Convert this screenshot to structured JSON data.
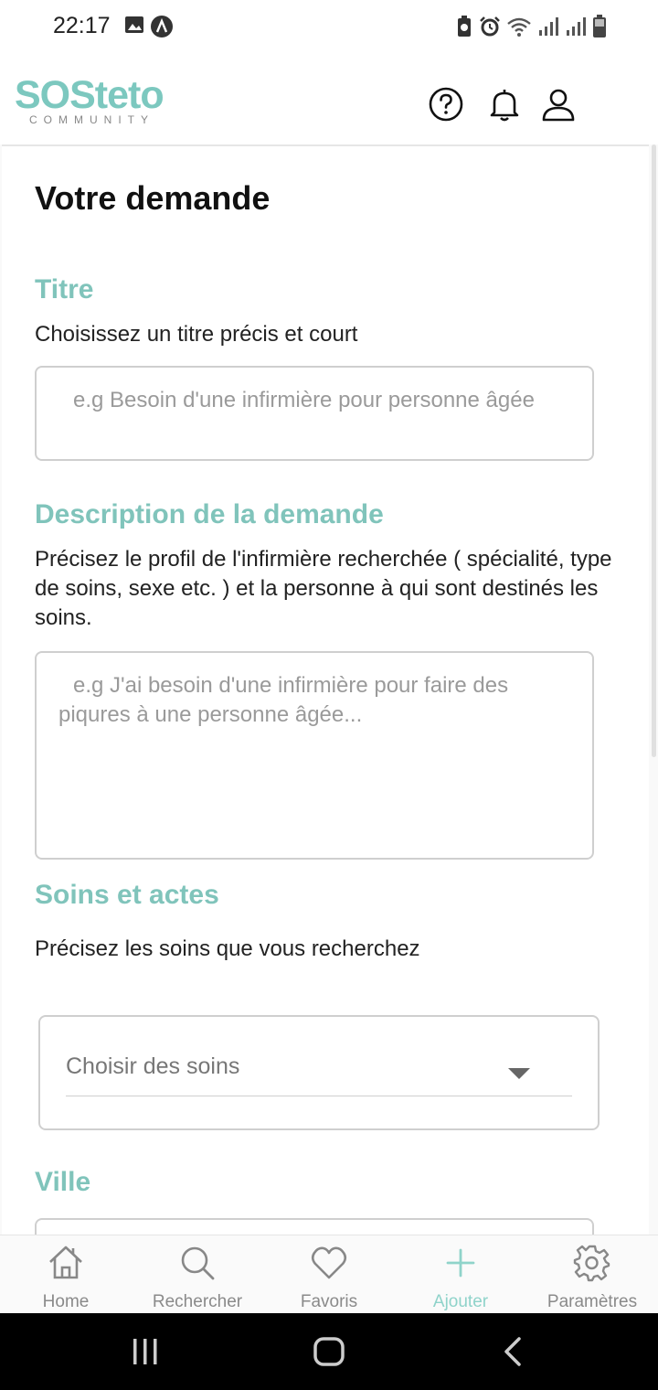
{
  "status_bar": {
    "time": "22:17",
    "icons": [
      "image-icon",
      "app-icon",
      "battery-saver-icon",
      "alarm-icon",
      "wifi-icon",
      "signal-icon",
      "signal-icon",
      "battery-icon"
    ]
  },
  "header": {
    "logo_text": "SOSteto",
    "logo_subtext": "COMMUNITY",
    "icons": [
      "help-icon",
      "bell-icon",
      "user-icon"
    ]
  },
  "form": {
    "page_title": "Votre demande",
    "titre": {
      "label": "Titre",
      "hint": "Choisissez un titre précis et court",
      "placeholder": "e.g Besoin d'une infirmière pour personne âgée"
    },
    "description": {
      "label": "Description de la demande",
      "hint": "Précisez le profil de l'infirmière recherchée ( spécialité, type de soins, sexe etc. ) et la personne à qui sont destinés les soins.",
      "placeholder": "e.g J'ai besoin d'une infirmière pour faire des piqures à une personne âgée..."
    },
    "soins": {
      "label": "Soins et actes",
      "hint": "Précisez les soins que vous recherchez",
      "select_placeholder": "Choisir des soins"
    },
    "ville": {
      "label": "Ville"
    }
  },
  "bottom_nav": {
    "active": "Ajouter",
    "items": [
      {
        "label": "Home",
        "icon": "home-icon"
      },
      {
        "label": "Rechercher",
        "icon": "search-icon"
      },
      {
        "label": "Favoris",
        "icon": "heart-icon"
      },
      {
        "label": "Ajouter",
        "icon": "plus-icon"
      },
      {
        "label": "Paramètres",
        "icon": "gear-icon"
      }
    ]
  },
  "colors": {
    "accent": "#80c4bb",
    "active_tab": "#8fd3ca",
    "placeholder": "#9a9a9a"
  }
}
